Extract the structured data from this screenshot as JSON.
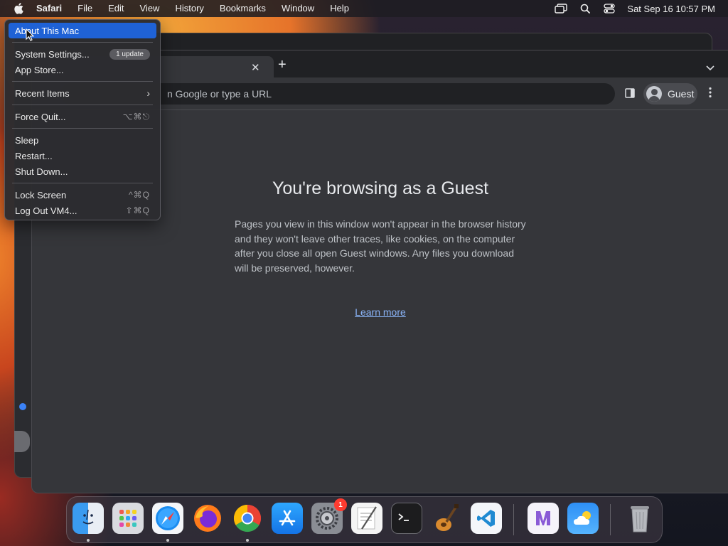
{
  "menubar": {
    "app_name": "Safari",
    "items": [
      "File",
      "Edit",
      "View",
      "History",
      "Bookmarks",
      "Window",
      "Help"
    ],
    "clock": "Sat Sep 16  10:57 PM"
  },
  "apple_menu": {
    "about": "About This Mac",
    "system_settings": "System Settings...",
    "system_settings_badge": "1 update",
    "app_store": "App Store...",
    "recent_items": "Recent Items",
    "force_quit": "Force Quit...",
    "force_quit_shortcut": "⌥⌘⎋",
    "sleep": "Sleep",
    "restart": "Restart...",
    "shut_down": "Shut Down...",
    "lock_screen": "Lock Screen",
    "lock_screen_shortcut": "^⌘Q",
    "log_out": "Log Out VM4...",
    "log_out_shortcut": "⇧⌘Q"
  },
  "browser": {
    "omnibox_text": "n Google or type a URL",
    "profile_label": "Guest",
    "title": "You're browsing as a Guest",
    "description": "Pages you view in this window won't appear in the browser history and they won't leave other traces, like cookies, on the computer after you close all open Guest windows. Any files you download will be preserved, however.",
    "learn_more": "Learn more"
  },
  "dock": {
    "system_settings_badge": "1",
    "apps": [
      "finder-icon",
      "launchpad-icon",
      "safari-icon",
      "firefox-icon",
      "chrome-icon",
      "app-store-icon",
      "system-settings-icon",
      "textedit-icon",
      "terminal-icon",
      "garageband-icon",
      "vscode-icon",
      "visual-studio-icon",
      "weather-icon",
      "trash-icon"
    ]
  },
  "colors": {
    "highlight": "#1f62d6",
    "link": "#8ab4f8",
    "browser_bg": "#35363a"
  }
}
